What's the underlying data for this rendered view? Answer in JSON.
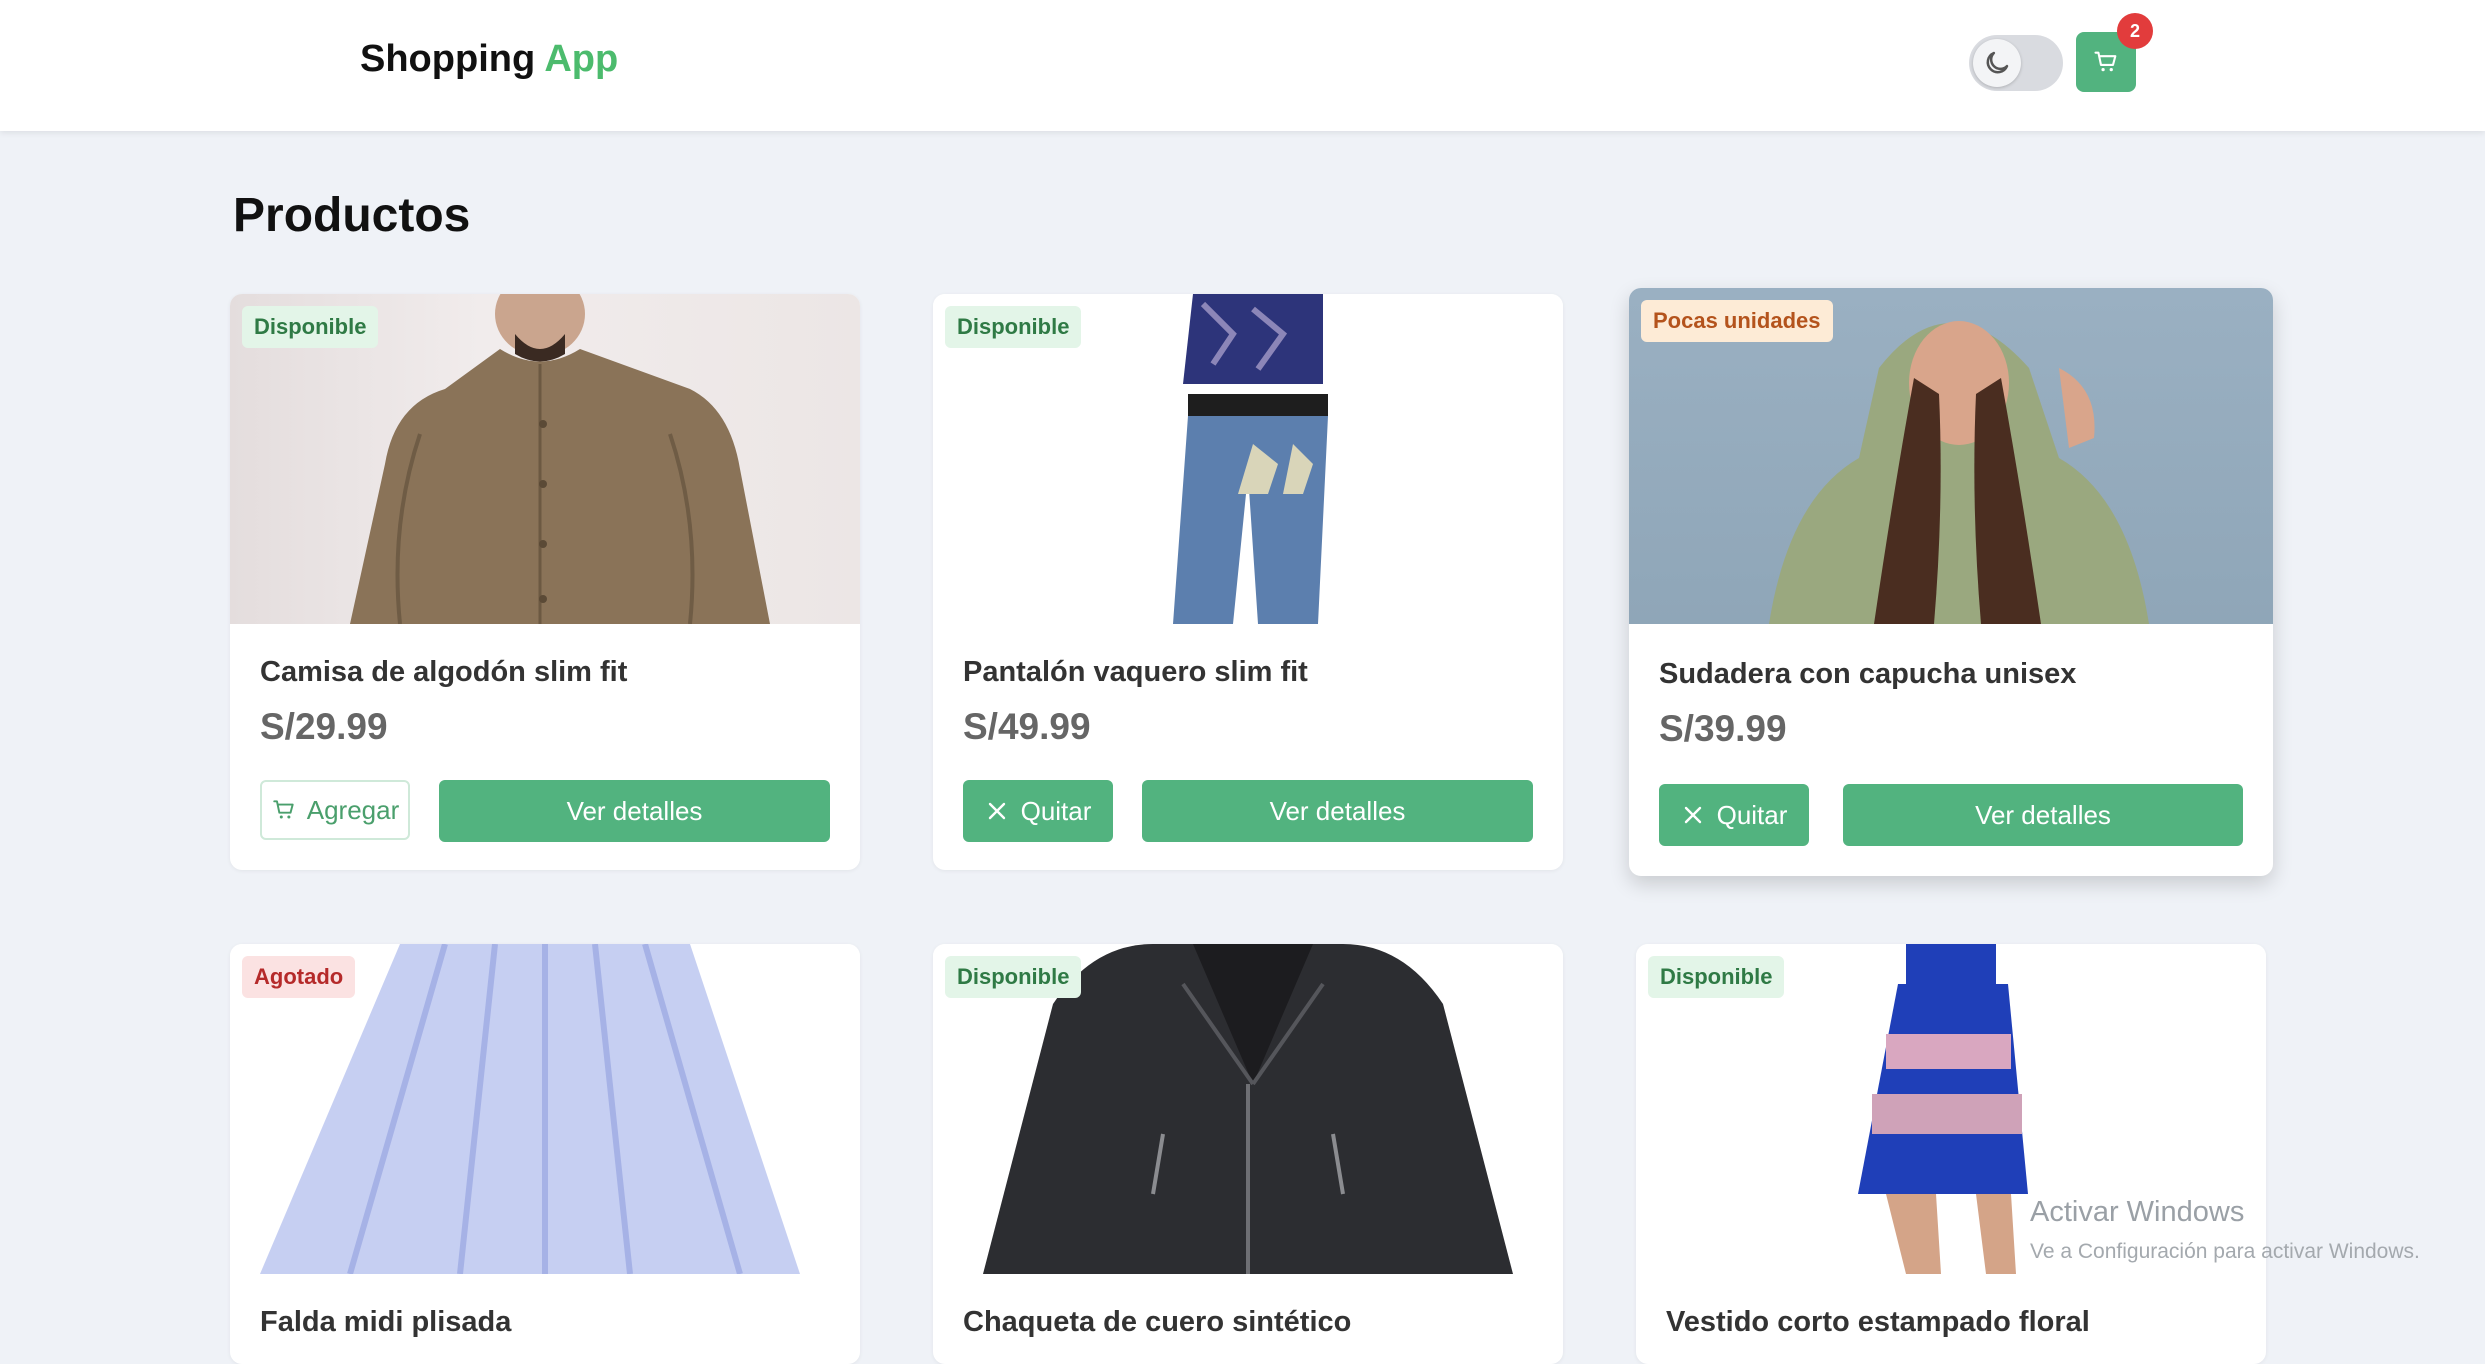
{
  "header": {
    "brand_main": "Shopping ",
    "brand_accent": "App",
    "cart_count": "2",
    "theme_icon": "moon-icon",
    "cart_icon": "cart-icon"
  },
  "main": {
    "title": "Productos"
  },
  "products": [
    {
      "status": "Disponible",
      "name": "Camisa de algodón slim fit",
      "price": "S/29.99",
      "action": "Agregar",
      "details": "Ver detalles"
    },
    {
      "status": "Disponible",
      "name": "Pantalón vaquero slim fit",
      "price": "S/49.99",
      "action": "Quitar",
      "details": "Ver detalles"
    },
    {
      "status": "Pocas unidades",
      "name": "Sudadera con capucha unisex",
      "price": "S/39.99",
      "action": "Quitar",
      "details": "Ver detalles"
    },
    {
      "status": "Agotado",
      "name": "Falda midi plisada"
    },
    {
      "status": "Disponible",
      "name": "Chaqueta de cuero sintético"
    },
    {
      "status": "Disponible",
      "name": "Vestido corto estampado floral"
    }
  ],
  "watermark": {
    "title": "Activar Windows",
    "subtitle": "Ve a Configuración para activar Windows."
  },
  "colors": {
    "accent": "#52b37f",
    "brand_accent": "#4cbb6d",
    "badge_red": "#e23c3c"
  }
}
